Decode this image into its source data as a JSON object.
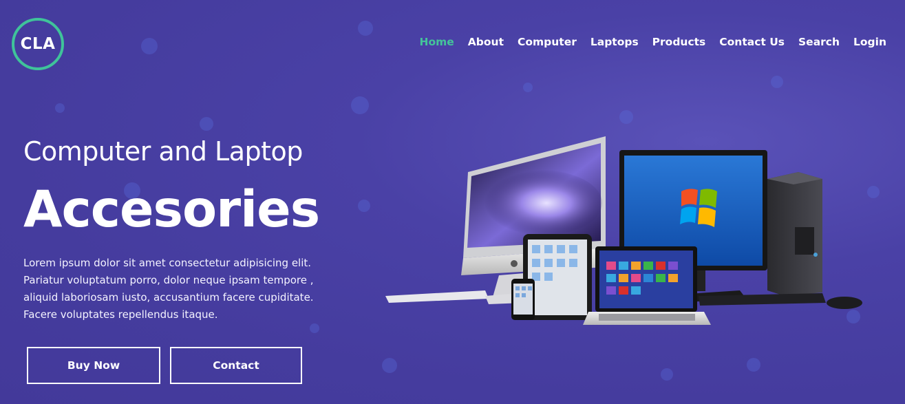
{
  "logo": {
    "text": "CLA"
  },
  "nav": [
    {
      "label": "Home",
      "active": true
    },
    {
      "label": "About"
    },
    {
      "label": "Computer"
    },
    {
      "label": "Laptops"
    },
    {
      "label": "Products"
    },
    {
      "label": "Contact Us"
    },
    {
      "label": "Search"
    },
    {
      "label": "Login"
    }
  ],
  "hero": {
    "subtitle": "Computer and Laptop",
    "title": "Accesories",
    "description": "Lorem ipsum dolor sit amet consectetur adipisicing elit. Pariatur voluptatum porro, dolor neque ipsam tempore , aliquid laboriosam iusto, accusantium facere cupiditate. Facere voluptates repellendus itaque.",
    "buy_label": "Buy Now",
    "contact_label": "Contact"
  },
  "colors": {
    "background": "#4a41a6",
    "accent": "#44c49a"
  },
  "hero_image": {
    "icon": "computer-devices-illustration"
  }
}
